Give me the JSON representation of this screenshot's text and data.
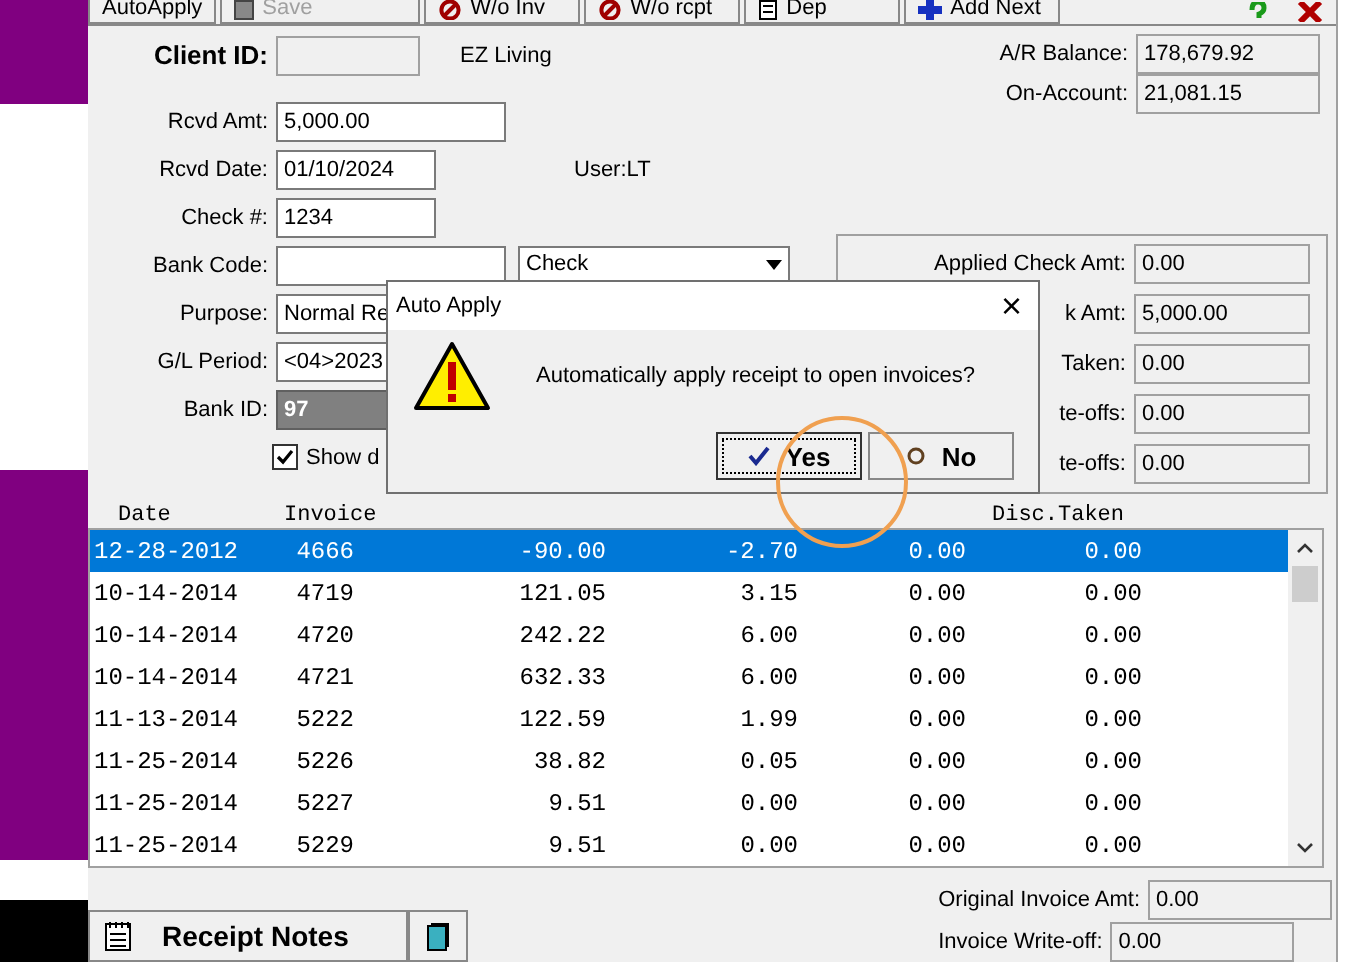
{
  "toolbar": {
    "buttons": [
      {
        "label": "AutoApply",
        "kind": "text",
        "disabled": false
      },
      {
        "label": "Save",
        "kind": "disk",
        "disabled": true
      },
      {
        "label": "W/o Inv",
        "kind": "ban",
        "disabled": false
      },
      {
        "label": "W/o rcpt",
        "kind": "ban",
        "disabled": false
      },
      {
        "label": "Dep",
        "kind": "doc",
        "disabled": false
      },
      {
        "label": "Add Next",
        "kind": "plus",
        "disabled": false
      }
    ]
  },
  "client": {
    "label": "Client ID:",
    "name": "EZ Living"
  },
  "balances": [
    {
      "label": "A/R Balance:",
      "value": "178,679.92"
    },
    {
      "label": "On-Account:",
      "value": "21,081.15"
    }
  ],
  "fields": [
    {
      "label": "Rcvd Amt:",
      "value": "5,000.00",
      "kind": "input"
    },
    {
      "label": "Rcvd Date:",
      "value": "01/10/2024",
      "kind": "input"
    },
    {
      "label": "Check #:",
      "value": "1234",
      "kind": "input"
    },
    {
      "label": "Bank Code:",
      "kind": "input",
      "dropdown": "Check"
    },
    {
      "label": "Purpose:",
      "value": "Normal Re",
      "kind": "input"
    },
    {
      "label": "G/L Period:",
      "value": "<04>2023",
      "kind": "input"
    },
    {
      "label": "Bank ID:",
      "value": "97",
      "kind": "readonly"
    }
  ],
  "user": "User:LT",
  "show_checkbox": {
    "label": "Show d",
    "checked": true
  },
  "totals": [
    {
      "label": "Applied Check Amt:",
      "value": "0.00"
    },
    {
      "label": "k Amt:",
      "value": "5,000.00"
    },
    {
      "label": "Taken:",
      "value": "0.00"
    },
    {
      "label": "te-offs:",
      "value": "0.00"
    },
    {
      "label": "te-offs:",
      "value": "0.00"
    }
  ],
  "table": {
    "headers": {
      "date": "Date",
      "invoice": "Invoice",
      "column_6": "Disc.Taken"
    },
    "rows": [
      {
        "date": "12-28-2012",
        "invoice": "4666",
        "column_3": "-90.00",
        "column_4": "-2.70",
        "column_5": "0.00",
        "column_6": "0.00",
        "selected": true
      },
      {
        "date": "10-14-2014",
        "invoice": "4719",
        "column_3": "121.05",
        "column_4": "3.15",
        "column_5": "0.00",
        "column_6": "0.00",
        "selected": false
      },
      {
        "date": "10-14-2014",
        "invoice": "4720",
        "column_3": "242.22",
        "column_4": "6.00",
        "column_5": "0.00",
        "column_6": "0.00",
        "selected": false
      },
      {
        "date": "10-14-2014",
        "invoice": "4721",
        "column_3": "632.33",
        "column_4": "6.00",
        "column_5": "0.00",
        "column_6": "0.00",
        "selected": false
      },
      {
        "date": "11-13-2014",
        "invoice": "5222",
        "column_3": "122.59",
        "column_4": "1.99",
        "column_5": "0.00",
        "column_6": "0.00",
        "selected": false
      },
      {
        "date": "11-25-2014",
        "invoice": "5226",
        "column_3": "38.82",
        "column_4": "0.05",
        "column_5": "0.00",
        "column_6": "0.00",
        "selected": false
      },
      {
        "date": "11-25-2014",
        "invoice": "5227",
        "column_3": "9.51",
        "column_4": "0.00",
        "column_5": "0.00",
        "column_6": "0.00",
        "selected": false
      },
      {
        "date": "11-25-2014",
        "invoice": "5229",
        "column_3": "9.51",
        "column_4": "0.00",
        "column_5": "0.00",
        "column_6": "0.00",
        "selected": false
      }
    ]
  },
  "notes_button": "Receipt Notes",
  "invoice_fields": [
    {
      "label": "Original Invoice Amt:",
      "value": "0.00"
    },
    {
      "label": "Invoice Write-off:",
      "value": "0.00"
    }
  ],
  "dialog": {
    "title": "Auto Apply",
    "close": "×",
    "message": "Automatically apply receipt to open invoices?",
    "buttons": [
      {
        "label": "Yes",
        "kind": "check",
        "selected": true
      },
      {
        "label": "No",
        "kind": "cancel",
        "selected": false
      }
    ]
  }
}
